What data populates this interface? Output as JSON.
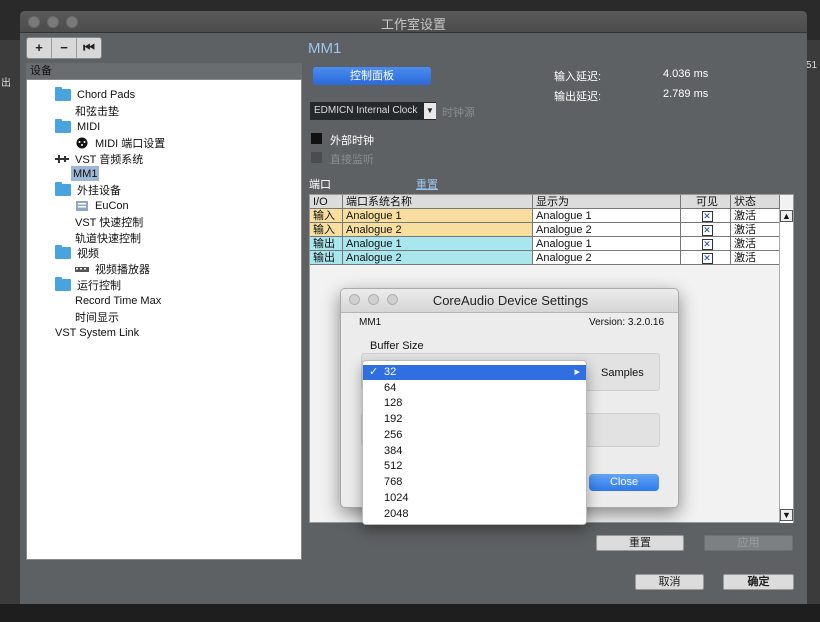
{
  "window": {
    "title": "工作室设置"
  },
  "toolbar": {
    "add": "+",
    "remove": "−",
    "reset": "⏮"
  },
  "background": {
    "left_text": "出",
    "right_text": "51"
  },
  "tree": {
    "header": "设备",
    "items": [
      {
        "label": "Chord Pads",
        "icon": "folder-icon"
      },
      {
        "label": "和弦击垫",
        "icon": ""
      },
      {
        "label": "MIDI",
        "icon": "folder-icon"
      },
      {
        "label": "MIDI 端口设置",
        "icon": "midi-port-icon"
      },
      {
        "label": "VST 音频系统",
        "icon": "audio-system-icon"
      },
      {
        "label": "MM1",
        "icon": ""
      },
      {
        "label": "外挂设备",
        "icon": "folder-icon"
      },
      {
        "label": "EuCon",
        "icon": "eucon-icon"
      },
      {
        "label": "VST 快速控制",
        "icon": ""
      },
      {
        "label": "轨道快速控制",
        "icon": ""
      },
      {
        "label": "视频",
        "icon": "folder-icon"
      },
      {
        "label": "视频播放器",
        "icon": "video-player-icon"
      },
      {
        "label": "运行控制",
        "icon": "folder-icon"
      },
      {
        "label": "Record Time Max",
        "icon": ""
      },
      {
        "label": "时间显示",
        "icon": ""
      },
      {
        "label": "VST System Link",
        "icon": ""
      }
    ]
  },
  "device": {
    "title": "MM1",
    "control_panel": "控制面板",
    "input_latency_label": "输入延迟:",
    "input_latency_value": "4.036 ms",
    "output_latency_label": "输出延迟:",
    "output_latency_value": "2.789 ms",
    "clock_source": "EDMICN Internal Clock",
    "clock_source_label": "时钟源",
    "external_clock": "外部时钟",
    "direct_monitoring": "直接监听",
    "ports_label": "端口",
    "ports_reset": "重置"
  },
  "ports": {
    "headers": [
      "I/O",
      "端口系统名称",
      "显示为",
      "可见",
      "状态"
    ],
    "rows": [
      {
        "io": "输入",
        "name": "Analogue 1",
        "show_as": "Analogue 1",
        "visible": "✕",
        "status": "激活"
      },
      {
        "io": "输入",
        "name": "Analogue 2",
        "show_as": "Analogue 2",
        "visible": "✕",
        "status": "激活"
      },
      {
        "io": "输出",
        "name": "Analogue 1",
        "show_as": "Analogue 1",
        "visible": "✕",
        "status": "激活"
      },
      {
        "io": "输出",
        "name": "Analogue 2",
        "show_as": "Analogue 2",
        "visible": "✕",
        "status": "激活"
      }
    ]
  },
  "panel_buttons": {
    "reset": "重置",
    "apply": "应用"
  },
  "footer": {
    "cancel": "取消",
    "ok": "确定"
  },
  "coreaudio": {
    "title": "CoreAudio Device Settings",
    "device": "MM1",
    "version": "Version: 3.2.0.16",
    "buffer_size_label": "Buffer Size",
    "samples": "Samples",
    "close": "Close",
    "buffer_options": [
      "32",
      "64",
      "128",
      "192",
      "256",
      "384",
      "512",
      "768",
      "1024",
      "2048"
    ],
    "selected_buffer": "32",
    "check": "✓"
  },
  "colors": {
    "accent_blue": "#2f6fe1",
    "input_row": "#f8dfa0",
    "output_row": "#a9e6ee",
    "window_bg": "#5e6163"
  }
}
